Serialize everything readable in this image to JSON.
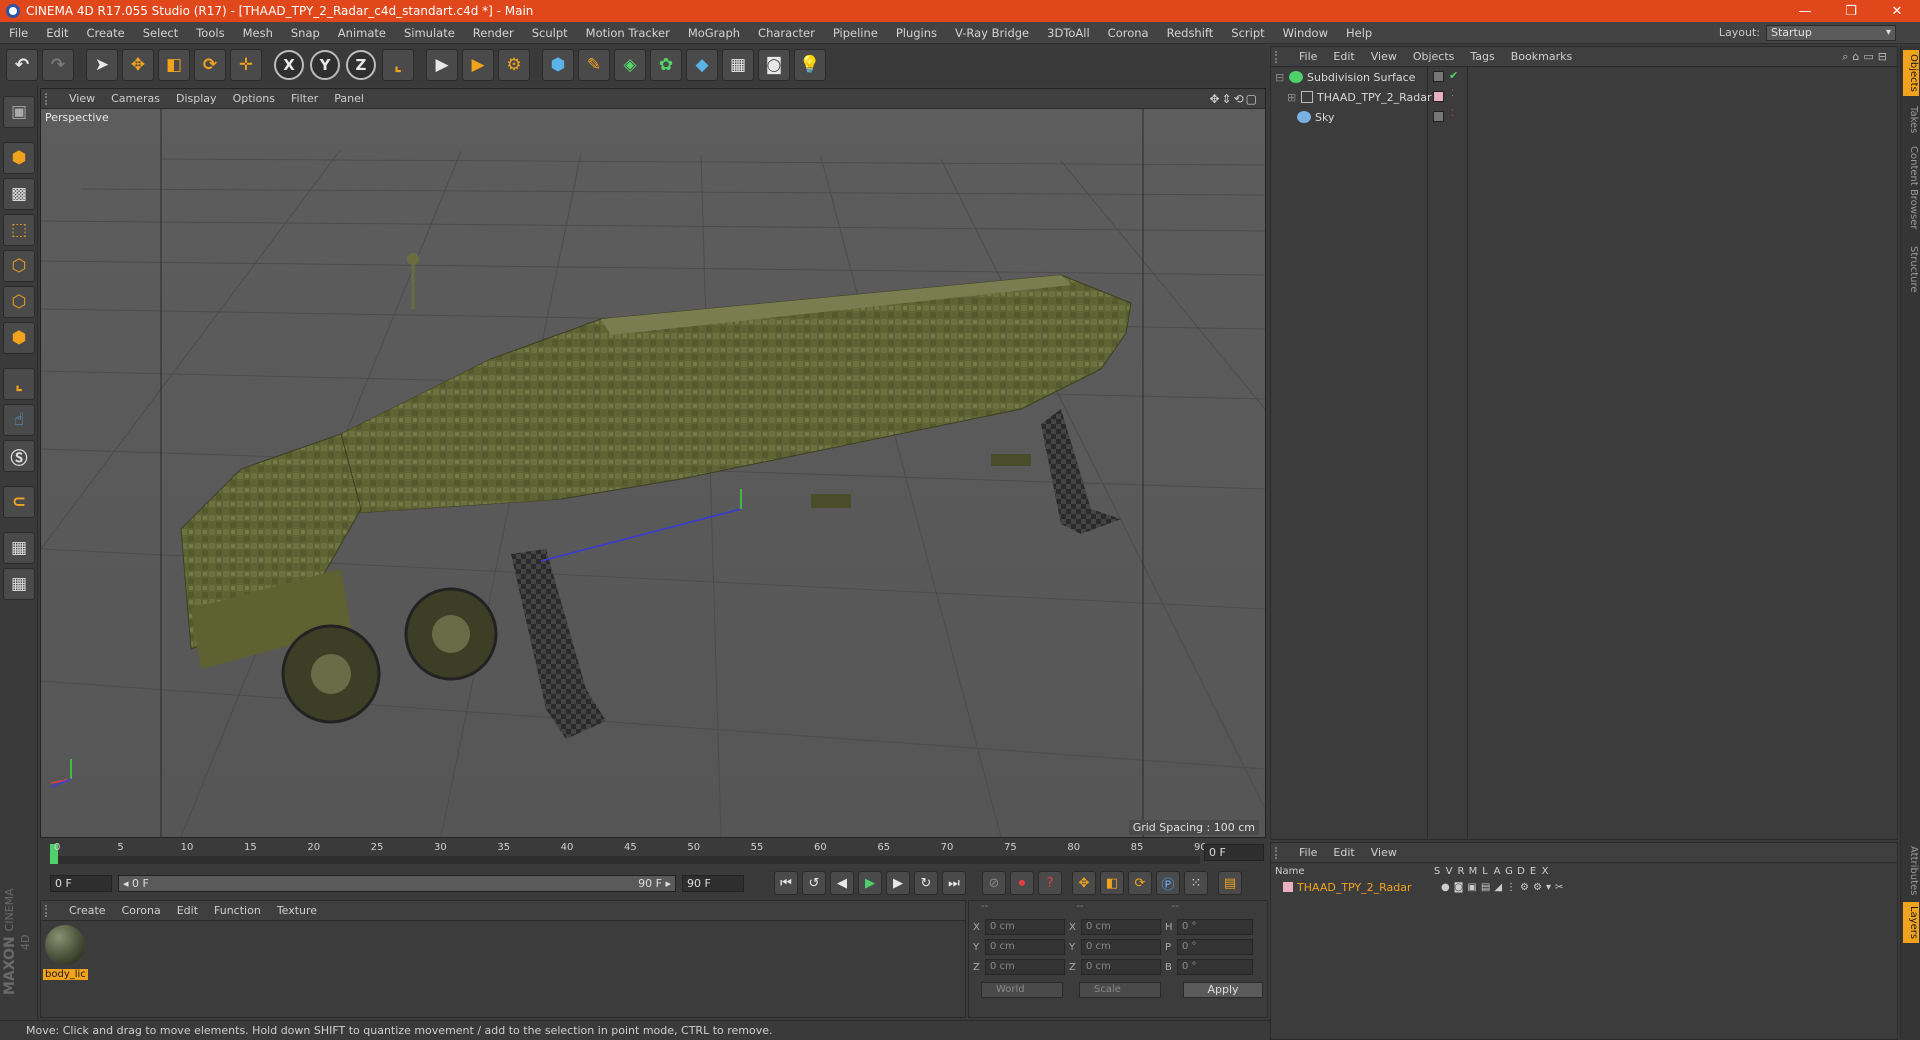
{
  "window": {
    "title": "CINEMA 4D R17.055 Studio (R17) - [THAAD_TPY_2_Radar_c4d_standart.c4d *] - Main",
    "minimize": "—",
    "maximize": "❐",
    "close": "✕"
  },
  "menu": {
    "items": [
      "File",
      "Edit",
      "Create",
      "Select",
      "Tools",
      "Mesh",
      "Snap",
      "Animate",
      "Simulate",
      "Render",
      "Sculpt",
      "Motion Tracker",
      "MoGraph",
      "Character",
      "Pipeline",
      "Plugins",
      "V-Ray Bridge",
      "3DToAll",
      "Corona",
      "Redshift",
      "Script",
      "Window",
      "Help"
    ],
    "layout_label": "Layout:",
    "layout_value": "Startup"
  },
  "toolbar": {
    "axis_x": "X",
    "axis_y": "Y",
    "axis_z": "Z"
  },
  "viewport": {
    "menu": [
      "View",
      "Cameras",
      "Display",
      "Options",
      "Filter",
      "Panel"
    ],
    "label": "Perspective",
    "grid_spacing": "Grid Spacing : 100 cm",
    "nav_icons": "✥⇕⟲▢"
  },
  "timeline": {
    "ticks": [
      "0",
      "5",
      "10",
      "15",
      "20",
      "25",
      "30",
      "35",
      "40",
      "45",
      "50",
      "55",
      "60",
      "65",
      "70",
      "75",
      "80",
      "85",
      "90"
    ],
    "current_frame": "0 F",
    "start_field": "0 F",
    "range_start": "◂ 0 F",
    "range_end": "90 F ▸",
    "end_field": "90 F"
  },
  "material_manager": {
    "menu": [
      "Create",
      "Corona",
      "Edit",
      "Function",
      "Texture"
    ],
    "material_label": "body_lic"
  },
  "coordinates": {
    "headers": [
      "--",
      "--",
      "--"
    ],
    "rows": [
      {
        "a": "X",
        "v1": "0 cm",
        "b": "X",
        "v2": "0 cm",
        "c": "H",
        "v3": "0 °"
      },
      {
        "a": "Y",
        "v1": "0 cm",
        "b": "Y",
        "v2": "0 cm",
        "c": "P",
        "v3": "0 °"
      },
      {
        "a": "Z",
        "v1": "0 cm",
        "b": "Z",
        "v2": "0 cm",
        "c": "B",
        "v3": "0 °"
      }
    ],
    "space": "World",
    "mode": "Scale",
    "apply": "Apply"
  },
  "object_manager": {
    "menu": [
      "File",
      "Edit",
      "View",
      "Objects",
      "Tags",
      "Bookmarks"
    ],
    "objects": [
      {
        "name": "Subdivision Surface"
      },
      {
        "name": "THAAD_TPY_2_Radar"
      },
      {
        "name": "Sky"
      }
    ]
  },
  "layer_manager": {
    "menu": [
      "File",
      "Edit",
      "View"
    ],
    "name_header": "Name",
    "columns": [
      "S",
      "V",
      "R",
      "M",
      "L",
      "A",
      "G",
      "D",
      "E",
      "X"
    ],
    "layer_name": "THAAD_TPY_2_Radar"
  },
  "side_tabs": [
    "Objects",
    "Takes",
    "Content Browser",
    "Structure"
  ],
  "side_tabs_bottom": [
    "Attributes",
    "Layers"
  ],
  "status": "Move: Click and drag to move elements. Hold down SHIFT to quantize movement / add to the selection in point mode, CTRL to remove.",
  "logo": {
    "brand": "MAXON",
    "product": "CINEMA 4D"
  },
  "colors": {
    "accent": "#f2a31e",
    "titlebar": "#e0471a",
    "panel": "#3c3c3c",
    "viewport": "#5a5a5a"
  }
}
